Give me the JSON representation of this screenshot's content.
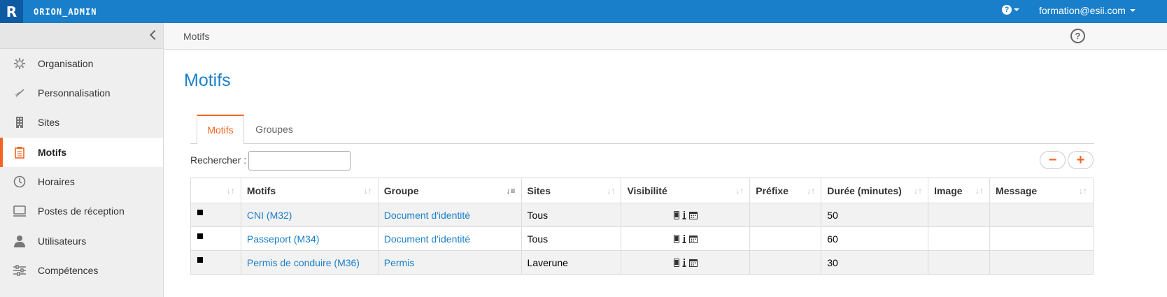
{
  "topbar": {
    "logo_letter": "R",
    "brand": "ORION_ADMIN",
    "help_symbol": "?",
    "user": "formation@esii.com"
  },
  "sidebar": {
    "items": [
      {
        "label": "Organisation",
        "icon": "gear-icon"
      },
      {
        "label": "Personnalisation",
        "icon": "brush-icon"
      },
      {
        "label": "Sites",
        "icon": "building-icon"
      },
      {
        "label": "Motifs",
        "icon": "clipboard-icon",
        "active": true
      },
      {
        "label": "Horaires",
        "icon": "clock-icon"
      },
      {
        "label": "Postes de réception",
        "icon": "monitor-icon"
      },
      {
        "label": "Utilisateurs",
        "icon": "user-icon"
      },
      {
        "label": "Compétences",
        "icon": "sliders-icon"
      }
    ]
  },
  "header": {
    "breadcrumb": "Motifs",
    "help_symbol": "?"
  },
  "main": {
    "title": "Motifs",
    "tabs": [
      {
        "label": "Motifs",
        "active": true
      },
      {
        "label": "Groupes",
        "active": false
      }
    ],
    "search": {
      "label": "Rechercher :",
      "value": ""
    },
    "remove_symbol": "−",
    "add_symbol": "+"
  },
  "table": {
    "columns": [
      "",
      "Motifs",
      "Groupe",
      "Sites",
      "Visibilité",
      "Préfixe",
      "Durée (minutes)",
      "Image",
      "Message"
    ],
    "sorted_column_index": 2,
    "rows": [
      {
        "motif": "CNI (M32)",
        "groupe": "Document d'identité",
        "sites": "Tous",
        "prefixe": "",
        "duree": "50",
        "image": "",
        "message": ""
      },
      {
        "motif": "Passeport (M34)",
        "groupe": "Document d'identité",
        "sites": "Tous",
        "prefixe": "",
        "duree": "60",
        "image": "",
        "message": ""
      },
      {
        "motif": "Permis de conduire (M36)",
        "groupe": "Permis",
        "sites": "Laverune",
        "prefixe": "",
        "duree": "30",
        "image": "",
        "message": ""
      }
    ]
  },
  "colors": {
    "accent_blue": "#1a7fcb",
    "accent_orange": "#f26522"
  }
}
